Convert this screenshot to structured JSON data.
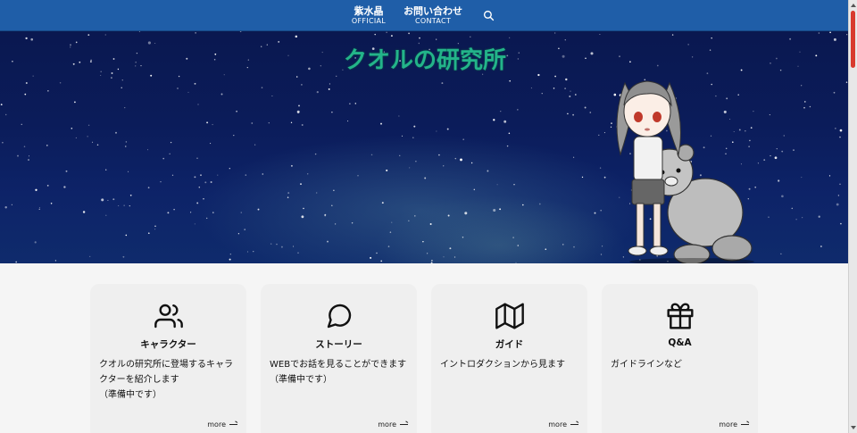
{
  "header": {
    "nav": [
      {
        "jp": "紫水晶",
        "en": "OFFICIAL"
      },
      {
        "jp": "お問い合わせ",
        "en": "CONTACT"
      }
    ],
    "search_icon": "search-icon"
  },
  "hero": {
    "title": "クオルの研究所"
  },
  "cards": [
    {
      "icon": "users-icon",
      "title": "キャラクター",
      "desc": "クオルの研究所に登場するキャラクターを紹介します\n（準備中です）",
      "more": "more"
    },
    {
      "icon": "chat-bubble-icon",
      "title": "ストーリー",
      "desc": "WEBでお話を見ることができます\n（準備中です）",
      "more": "more"
    },
    {
      "icon": "map-icon",
      "title": "ガイド",
      "desc": "イントロダクションから見ます",
      "more": "more"
    },
    {
      "icon": "gift-icon",
      "title": "Q&A",
      "desc": "ガイドラインなど",
      "more": "more"
    }
  ],
  "colors": {
    "header": "#1f5ea8",
    "title": "#23b48a",
    "scroll_thumb": "#d83a2e"
  }
}
